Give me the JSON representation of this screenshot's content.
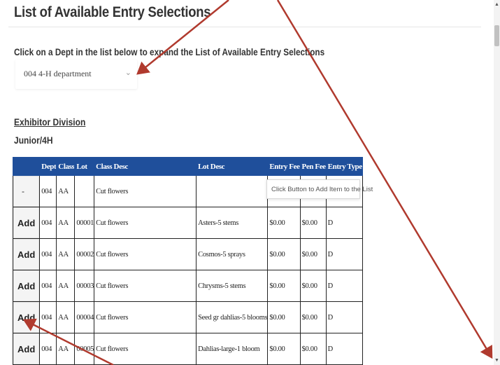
{
  "page": {
    "title": "List of Available Entry Selections",
    "instruction": "Click on a Dept in the list below to expand the List of Available Entry Selections",
    "dept_select": {
      "value": "004  4-H department"
    },
    "exhibitor_division_label": "Exhibitor Division",
    "division_name": "Junior/4H"
  },
  "table": {
    "headers": [
      "",
      "Dept",
      "Class",
      "Lot",
      "Class Desc",
      "Lot Desc",
      "Entry Fee",
      "Pen Fee",
      "Entry Type"
    ],
    "group_row": {
      "button": "-",
      "dept": "004",
      "class": "AA",
      "lot": "",
      "class_desc": "Cut flowers"
    },
    "rows": [
      {
        "button": "Add",
        "dept": "004",
        "class": "AA",
        "lot": "00001",
        "class_desc": "Cut flowers",
        "lot_desc": "Asters-5 stems",
        "entry_fee": "$0.00",
        "pen_fee": "$0.00",
        "entry_type": "D"
      },
      {
        "button": "Add",
        "dept": "004",
        "class": "AA",
        "lot": "00002",
        "class_desc": "Cut flowers",
        "lot_desc": "Cosmos-5 sprays",
        "entry_fee": "$0.00",
        "pen_fee": "$0.00",
        "entry_type": "D"
      },
      {
        "button": "Add",
        "dept": "004",
        "class": "AA",
        "lot": "00003",
        "class_desc": "Cut flowers",
        "lot_desc": "Chrysms-5 stems",
        "entry_fee": "$0.00",
        "pen_fee": "$0.00",
        "entry_type": "D"
      },
      {
        "button": "Add",
        "dept": "004",
        "class": "AA",
        "lot": "00004",
        "class_desc": "Cut flowers",
        "lot_desc": "Seed gr dahlias-5 blooms",
        "entry_fee": "$0.00",
        "pen_fee": "$0.00",
        "entry_type": "D"
      },
      {
        "button": "Add",
        "dept": "004",
        "class": "AA",
        "lot": "00005",
        "class_desc": "Cut flowers",
        "lot_desc": "Dahlias-large-1 bloom",
        "entry_fee": "$0.00",
        "pen_fee": "$0.00",
        "entry_type": "D"
      }
    ]
  },
  "tooltip": {
    "text": "Click Button to Add Item to the List"
  },
  "annotations": {
    "arrow_color": "#b03a2e"
  },
  "colors": {
    "header_bg": "#1f4f9b"
  }
}
